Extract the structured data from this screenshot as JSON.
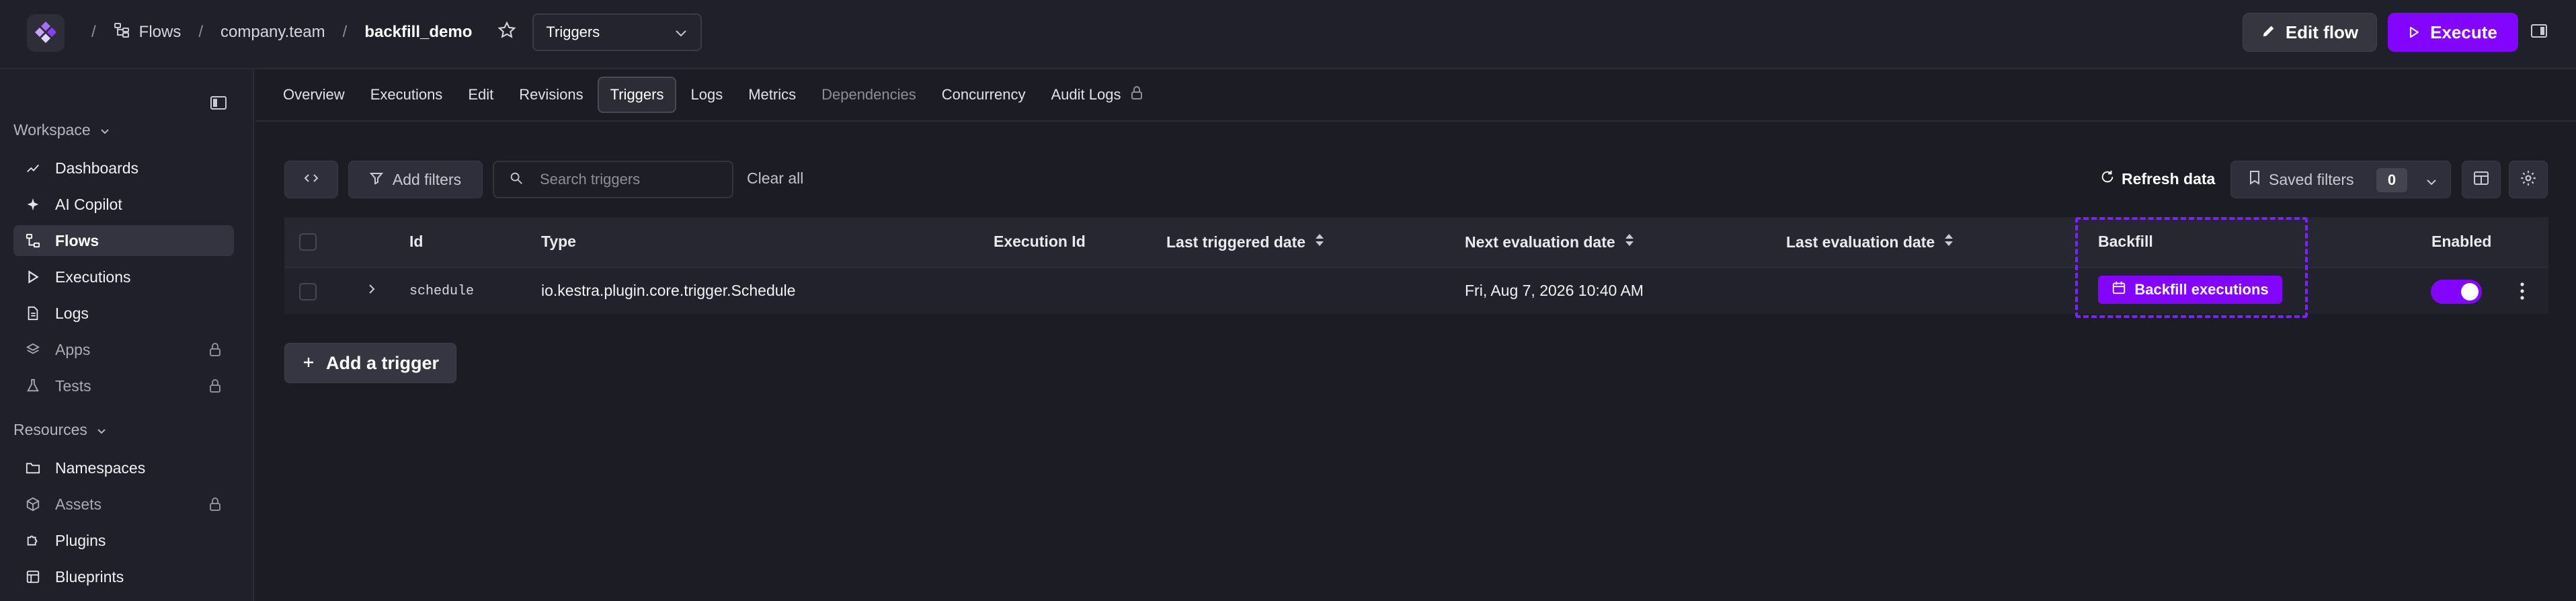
{
  "header": {
    "breadcrumb": [
      "Flows",
      "company.team",
      "backfill_demo"
    ],
    "view_select": "Triggers",
    "edit_label": "Edit flow",
    "execute_label": "Execute"
  },
  "sidebar": {
    "workspace_title": "Workspace",
    "workspace_items": [
      {
        "label": "Dashboards",
        "icon": "chart-line-icon"
      },
      {
        "label": "AI Copilot",
        "icon": "sparkle-icon"
      },
      {
        "label": "Flows",
        "icon": "flows-icon",
        "active": true
      },
      {
        "label": "Executions",
        "icon": "play-icon"
      },
      {
        "label": "Logs",
        "icon": "file-icon"
      },
      {
        "label": "Apps",
        "icon": "layers-icon",
        "locked": true
      },
      {
        "label": "Tests",
        "icon": "flask-icon",
        "locked": true
      }
    ],
    "resources_title": "Resources",
    "resources_items": [
      {
        "label": "Namespaces",
        "icon": "folder-icon"
      },
      {
        "label": "Assets",
        "icon": "cube-icon",
        "locked": true
      },
      {
        "label": "Plugins",
        "icon": "puzzle-icon"
      },
      {
        "label": "Blueprints",
        "icon": "blueprint-icon"
      }
    ]
  },
  "tabs": [
    "Overview",
    "Executions",
    "Edit",
    "Revisions",
    "Triggers",
    "Logs",
    "Metrics",
    "Dependencies",
    "Concurrency",
    "Audit Logs"
  ],
  "active_tab": "Triggers",
  "filters": {
    "add_filters_label": "Add filters",
    "search_placeholder": "Search triggers",
    "clear_all_label": "Clear all",
    "refresh_label": "Refresh data",
    "saved_filters_label": "Saved filters",
    "saved_filters_count": "0"
  },
  "table": {
    "columns": [
      "Id",
      "Type",
      "Execution Id",
      "Last triggered date",
      "Next evaluation date",
      "Last evaluation date",
      "Backfill",
      "Enabled"
    ],
    "rows": [
      {
        "id": "schedule",
        "type": "io.kestra.plugin.core.trigger.Schedule",
        "execution_id": "",
        "last_triggered_date": "",
        "next_evaluation_date": "Fri, Aug 7, 2026 10:40 AM",
        "last_evaluation_date": "",
        "backfill_label": "Backfill executions",
        "enabled": true
      }
    ]
  },
  "add_trigger_label": "Add a trigger",
  "colors": {
    "accent": "#8405ff",
    "background": "#1b1c24",
    "highlight": "#7b22ff"
  }
}
